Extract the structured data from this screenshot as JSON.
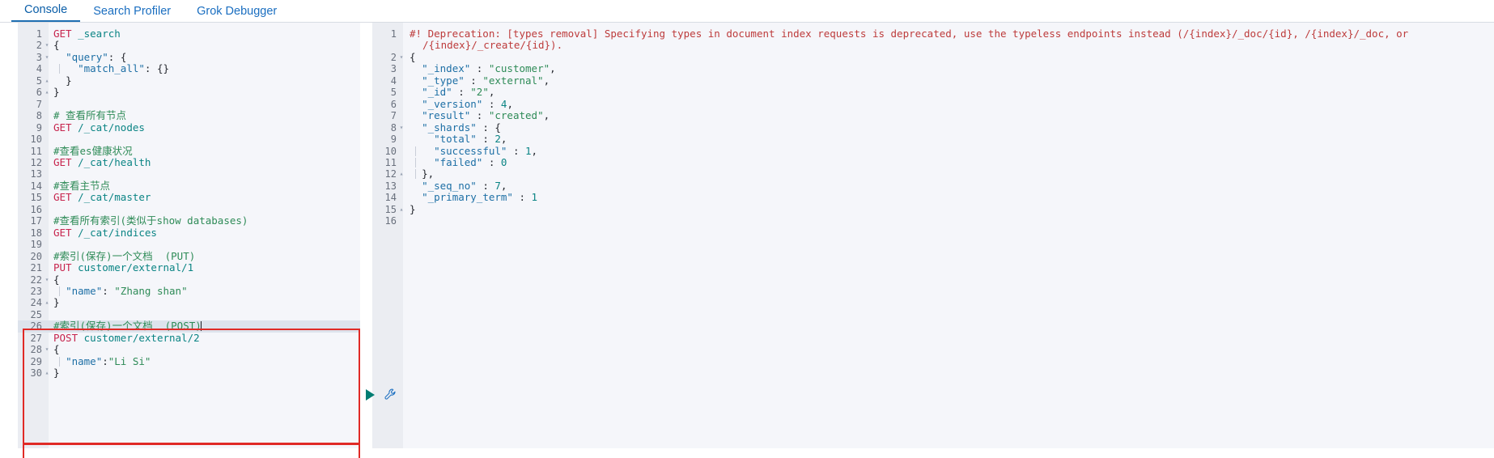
{
  "tabs": [
    {
      "label": "Console",
      "active": true
    },
    {
      "label": "Search Profiler",
      "active": false
    },
    {
      "label": "Grok Debugger",
      "active": false
    }
  ],
  "icons": {
    "play": "play-icon",
    "wrench": "wrench-icon"
  },
  "colors": {
    "accent": "#1f6fb2",
    "annotation": "#e02a26",
    "method": "#c7254e",
    "path": "#0a8484",
    "comment": "#2e8b57",
    "key": "#1d6fa5",
    "string": "#2e8b57",
    "number": "#0a8484",
    "warning": "#bd3b3b",
    "play": "#017d73",
    "highlight_row": "#dde3ec"
  },
  "editor": {
    "name": "console-request-editor",
    "lines": [
      {
        "n": "1",
        "fold": "",
        "text": "GET _search"
      },
      {
        "n": "2",
        "fold": "▾",
        "text": "{"
      },
      {
        "n": "3",
        "fold": "▾",
        "text": "  \"query\": {"
      },
      {
        "n": "4",
        "fold": "",
        "text": "    \"match_all\": {}"
      },
      {
        "n": "5",
        "fold": "▴",
        "text": "  }"
      },
      {
        "n": "6",
        "fold": "▴",
        "text": "}"
      },
      {
        "n": "7",
        "fold": "",
        "text": ""
      },
      {
        "n": "8",
        "fold": "",
        "text": "# 查看所有节点"
      },
      {
        "n": "9",
        "fold": "",
        "text": "GET /_cat/nodes"
      },
      {
        "n": "10",
        "fold": "",
        "text": ""
      },
      {
        "n": "11",
        "fold": "",
        "text": "#查看es健康状况"
      },
      {
        "n": "12",
        "fold": "",
        "text": "GET /_cat/health"
      },
      {
        "n": "13",
        "fold": "",
        "text": ""
      },
      {
        "n": "14",
        "fold": "",
        "text": "#查看主节点"
      },
      {
        "n": "15",
        "fold": "",
        "text": "GET /_cat/master"
      },
      {
        "n": "16",
        "fold": "",
        "text": ""
      },
      {
        "n": "17",
        "fold": "",
        "text": "#查看所有索引(类似于show databases)"
      },
      {
        "n": "18",
        "fold": "",
        "text": "GET /_cat/indices"
      },
      {
        "n": "19",
        "fold": "",
        "text": ""
      },
      {
        "n": "20",
        "fold": "",
        "text": "#索引(保存)一个文档  (PUT)"
      },
      {
        "n": "21",
        "fold": "",
        "text": "PUT customer/external/1"
      },
      {
        "n": "22",
        "fold": "▾",
        "text": "{"
      },
      {
        "n": "23",
        "fold": "",
        "text": "  \"name\": \"Zhang shan\""
      },
      {
        "n": "24",
        "fold": "▴",
        "text": "}"
      },
      {
        "n": "25",
        "fold": "",
        "text": ""
      },
      {
        "n": "26",
        "fold": "",
        "text": "#索引(保存)一个文档  (POST)"
      },
      {
        "n": "27",
        "fold": "",
        "text": "POST customer/external/2"
      },
      {
        "n": "28",
        "fold": "▾",
        "text": "{"
      },
      {
        "n": "29",
        "fold": "",
        "text": "  \"name\":\"Li Si\""
      },
      {
        "n": "30",
        "fold": "▴",
        "text": "}"
      }
    ]
  },
  "response": {
    "name": "console-response-viewer",
    "warning_line1": "#! Deprecation: [types removal] Specifying types in document index requests is deprecated, use the typeless endpoints instead (/{index}/_doc/{id}, /{index}/_doc, or",
    "warning_line2": "/{index}/_create/{id}).",
    "lines": [
      {
        "n": "2",
        "fold": "▾",
        "text": "{"
      },
      {
        "n": "3",
        "fold": "",
        "text": "  \"_index\" : \"customer\","
      },
      {
        "n": "4",
        "fold": "",
        "text": "  \"_type\" : \"external\","
      },
      {
        "n": "5",
        "fold": "",
        "text": "  \"_id\" : \"2\","
      },
      {
        "n": "6",
        "fold": "",
        "text": "  \"_version\" : 4,"
      },
      {
        "n": "7",
        "fold": "",
        "text": "  \"result\" : \"created\","
      },
      {
        "n": "8",
        "fold": "▾",
        "text": "  \"_shards\" : {"
      },
      {
        "n": "9",
        "fold": "",
        "text": "    \"total\" : 2,"
      },
      {
        "n": "10",
        "fold": "",
        "text": "    \"successful\" : 1,"
      },
      {
        "n": "11",
        "fold": "",
        "text": "    \"failed\" : 0"
      },
      {
        "n": "12",
        "fold": "▴",
        "text": "  },"
      },
      {
        "n": "13",
        "fold": "",
        "text": "  \"_seq_no\" : 7,"
      },
      {
        "n": "14",
        "fold": "",
        "text": "  \"_primary_term\" : 1"
      },
      {
        "n": "15",
        "fold": "▴",
        "text": "}"
      },
      {
        "n": "16",
        "fold": "",
        "text": ""
      }
    ]
  }
}
